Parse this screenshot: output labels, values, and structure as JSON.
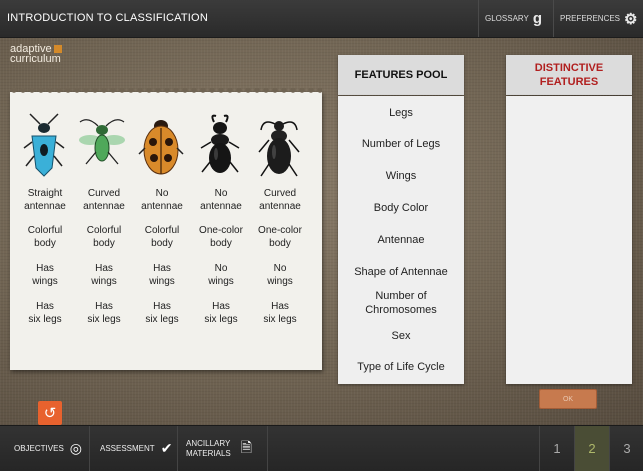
{
  "app": {
    "title": "INTRODUCTION TO CLASSIFICATION",
    "glossary_label": "GLOSSARY",
    "glossary_icon": "g",
    "preferences_label": "PREFERENCES",
    "preferences_icon": "⚙"
  },
  "logo": {
    "line1": "adaptive",
    "line2": "curriculum"
  },
  "insects": [
    {
      "icon": "blue-beetle",
      "color": "#3ab0d8",
      "antennae": [
        "Straight",
        "antennae"
      ],
      "body": [
        "Colorful",
        "body"
      ],
      "wings": [
        "Has",
        "wings"
      ],
      "legs": [
        "Has",
        "six legs"
      ]
    },
    {
      "icon": "green-fly",
      "color": "#4fa85a",
      "antennae": [
        "Curved",
        "antennae"
      ],
      "body": [
        "Colorful",
        "body"
      ],
      "wings": [
        "Has",
        "wings"
      ],
      "legs": [
        "Has",
        "six legs"
      ]
    },
    {
      "icon": "orange-beetle",
      "color": "#d98a2a",
      "antennae": [
        "No",
        "antennae"
      ],
      "body": [
        "Colorful",
        "body"
      ],
      "wings": [
        "Has",
        "wings"
      ],
      "legs": [
        "Has",
        "six legs"
      ]
    },
    {
      "icon": "black-stag-beetle",
      "color": "#151515",
      "antennae": [
        "No",
        "antennae"
      ],
      "body": [
        "One-color",
        "body"
      ],
      "wings": [
        "No",
        "wings"
      ],
      "legs": [
        "Has",
        "six legs"
      ]
    },
    {
      "icon": "black-weevil",
      "color": "#1c1c1c",
      "antennae": [
        "Curved",
        "antennae"
      ],
      "body": [
        "One-color",
        "body"
      ],
      "wings": [
        "No",
        "wings"
      ],
      "legs": [
        "Has",
        "six legs"
      ]
    }
  ],
  "features_pool": {
    "title": "FEATURES POOL",
    "items": [
      "Legs",
      "Number of Legs",
      "Wings",
      "Body Color",
      "Antennae",
      "Shape of Antennae",
      "Number of Chromosomes",
      "Sex",
      "Type of Life Cycle"
    ]
  },
  "distinctive": {
    "title_line1": "DISTINCTIVE",
    "title_line2": "FEATURES"
  },
  "ok_label": "OK",
  "reset_icon": "↺",
  "bottom": {
    "objectives_label": "OBJECTIVES",
    "objectives_icon": "◎",
    "assessment_label": "ASSESSMENT",
    "assessment_icon": "✔",
    "ancillary_line1": "ANCILLARY",
    "ancillary_line2": "MATERIALS",
    "ancillary_icon": "🗎",
    "pages": [
      "1",
      "2",
      "3"
    ],
    "active_page": "2"
  },
  "colors": {
    "accent": "#b11f1f",
    "reset": "#e8622e",
    "ok": "#c77a4e",
    "active_page": "#aeb86a"
  }
}
